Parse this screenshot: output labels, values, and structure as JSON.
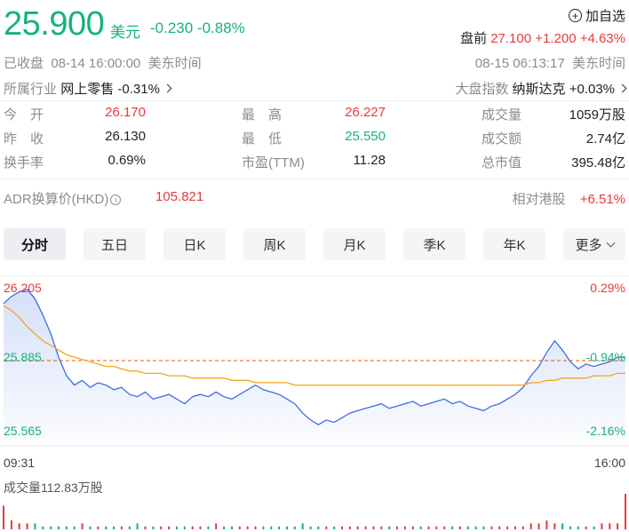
{
  "quote": {
    "price": "25.900",
    "currency": "美元",
    "change": "-0.230 -0.88%",
    "watch_label": "加自选",
    "premarket_label": "盘前",
    "premarket_value": "27.100 +1.200 +4.63%",
    "close_status": "已收盘  08-14 16:00:00  美东时间",
    "premarket_time": "08-15 06:13:17  美东时间",
    "industry_label": "所属行业",
    "industry_name": "网上零售",
    "industry_change": "-0.31%",
    "index_label": "大盘指数",
    "index_name": "纳斯达克",
    "index_change": "+0.03%"
  },
  "stats": [
    {
      "label": "今　开",
      "value": "26.170",
      "color": "#e8393a"
    },
    {
      "label": "最　高",
      "value": "26.227",
      "color": "#e8393a"
    },
    {
      "label": "成交量",
      "value": "1059万股",
      "color": "#222222"
    },
    {
      "label": "昨　收",
      "value": "26.130",
      "color": "#222222"
    },
    {
      "label": "最　低",
      "value": "25.550",
      "color": "#16b182"
    },
    {
      "label": "成交额",
      "value": "2.74亿",
      "color": "#222222"
    },
    {
      "label": "换手率",
      "value": "0.69%",
      "color": "#222222"
    },
    {
      "label": "市盈(TTM)",
      "value": "11.28",
      "color": "#222222"
    },
    {
      "label": "总市值",
      "value": "395.48亿",
      "color": "#222222"
    }
  ],
  "adr": {
    "label": "ADR换算价(HKD)",
    "value": "105.821",
    "hk_label": "相对港股",
    "hk_value": "+6.51%"
  },
  "tabs": [
    "分时",
    "五日",
    "日K",
    "周K",
    "月K",
    "季K",
    "年K",
    "更多"
  ],
  "axis": {
    "top_price": "26.205",
    "mid_price": "25.885",
    "bottom_price": "25.565",
    "top_pct": "0.29%",
    "mid_pct": "-0.94%",
    "bottom_pct": "-2.16%",
    "start_time": "09:31",
    "end_time": "16:00"
  },
  "volume_label": "成交量112.83万股",
  "colors": {
    "up": "#e8393a",
    "down": "#16b182",
    "price_line": "#3e6ee0",
    "avg_line": "#f2a51e"
  },
  "chart_data": {
    "type": "line",
    "x_range": [
      "09:31",
      "16:00"
    ],
    "ylim": [
      25.565,
      26.205
    ],
    "reference_price": 25.885,
    "series": [
      {
        "values": [
          26.13,
          26.16,
          26.18,
          26.19,
          26.15,
          26.08,
          26.0,
          25.9,
          25.82,
          25.78,
          25.8,
          25.77,
          25.79,
          25.78,
          25.76,
          25.77,
          25.74,
          25.73,
          25.75,
          25.72,
          25.73,
          25.74,
          25.72,
          25.7,
          25.73,
          25.74,
          25.73,
          25.75,
          25.73,
          25.72,
          25.74,
          25.76,
          25.78,
          25.76,
          25.75,
          25.74,
          25.72,
          25.7,
          25.66,
          25.63,
          25.61,
          25.63,
          25.62,
          25.64,
          25.66,
          25.67,
          25.68,
          25.69,
          25.7,
          25.68,
          25.69,
          25.7,
          25.71,
          25.69,
          25.7,
          25.71,
          25.72,
          25.7,
          25.71,
          25.69,
          25.68,
          25.67,
          25.69,
          25.7,
          25.72,
          25.74,
          25.77,
          25.82,
          25.86,
          25.92,
          25.97,
          25.93,
          25.88,
          25.85,
          25.87,
          25.86,
          25.87,
          25.88,
          25.9,
          25.9
        ]
      },
      {
        "values": [
          26.12,
          26.1,
          26.07,
          26.03,
          26.0,
          25.97,
          25.95,
          25.93,
          25.91,
          25.9,
          25.89,
          25.88,
          25.87,
          25.86,
          25.86,
          25.85,
          25.84,
          25.84,
          25.83,
          25.83,
          25.83,
          25.82,
          25.82,
          25.82,
          25.81,
          25.81,
          25.81,
          25.81,
          25.81,
          25.8,
          25.8,
          25.8,
          25.79,
          25.79,
          25.79,
          25.79,
          25.79,
          25.78,
          25.78,
          25.78,
          25.78,
          25.78,
          25.78,
          25.78,
          25.78,
          25.78,
          25.78,
          25.78,
          25.78,
          25.78,
          25.78,
          25.78,
          25.78,
          25.78,
          25.78,
          25.78,
          25.78,
          25.78,
          25.78,
          25.78,
          25.78,
          25.78,
          25.78,
          25.78,
          25.78,
          25.78,
          25.78,
          25.79,
          25.79,
          25.8,
          25.8,
          25.81,
          25.81,
          25.81,
          25.81,
          25.82,
          25.82,
          25.82,
          25.83,
          25.83
        ]
      }
    ],
    "volume": [
      8,
      3,
      2,
      2,
      2,
      1,
      1,
      1,
      1,
      1,
      2,
      1,
      1,
      1,
      1,
      1,
      1,
      2,
      1,
      1,
      1,
      1,
      1,
      1,
      1,
      1,
      1,
      2,
      1,
      1,
      1,
      1,
      1,
      1,
      1,
      1,
      1,
      1,
      2,
      1,
      1,
      1,
      1,
      1,
      1,
      1,
      1,
      1,
      1,
      1,
      1,
      1,
      1,
      1,
      1,
      1,
      1,
      1,
      1,
      1,
      1,
      1,
      1,
      1,
      1,
      1,
      1,
      2,
      2,
      3,
      2,
      2,
      1,
      1,
      1,
      1,
      2,
      2,
      2,
      12
    ]
  }
}
